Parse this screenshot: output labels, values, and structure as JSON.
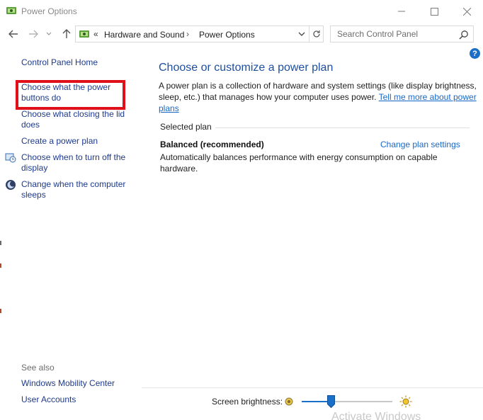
{
  "window": {
    "title": "Power Options",
    "controls": {
      "minimize": "minimize",
      "maximize": "maximize",
      "close": "close"
    }
  },
  "address_bar": {
    "overflow_chevron": "«",
    "breadcrumbs": [
      "Hardware and Sound",
      "Power Options"
    ],
    "separator": "›"
  },
  "search": {
    "placeholder": "Search Control Panel"
  },
  "left_panel": {
    "home": "Control Panel Home",
    "links": [
      "Choose what the power buttons do",
      "Choose what closing the lid does",
      "Create a power plan",
      "Choose when to turn off the display",
      "Change when the computer sleeps"
    ],
    "see_also_heading": "See also",
    "see_also": [
      "Windows Mobility Center",
      "User Accounts"
    ],
    "highlight_color": "#e0101a"
  },
  "main": {
    "heading": "Choose or customize a power plan",
    "description": "A power plan is a collection of hardware and system settings (like display brightness, sleep, etc.) that manages how your computer uses power. ",
    "learn_more_link": "Tell me more about power plans",
    "selected_plan_label": "Selected plan",
    "plan": {
      "name": "Balanced (recommended)",
      "change_link": "Change plan settings",
      "description": "Automatically balances performance with energy consumption on capable hardware."
    }
  },
  "brightness": {
    "label": "Screen brightness:",
    "level_percent": 32
  },
  "watermark": "Activate Windows",
  "colors": {
    "link": "#1668c8",
    "heading": "#1e4fa0",
    "accent": "#1a6fc9"
  },
  "icons": {
    "app": "power-options-icon",
    "back": "back-arrow-icon",
    "forward": "forward-arrow-icon",
    "recent": "chevron-down-icon",
    "up": "up-arrow-icon",
    "refresh": "refresh-icon",
    "search": "search-icon",
    "help": "help-icon",
    "display": "display-timer-icon",
    "sleep": "sleep-moon-icon",
    "dim": "dim-sun-icon",
    "bright": "bright-sun-icon"
  }
}
